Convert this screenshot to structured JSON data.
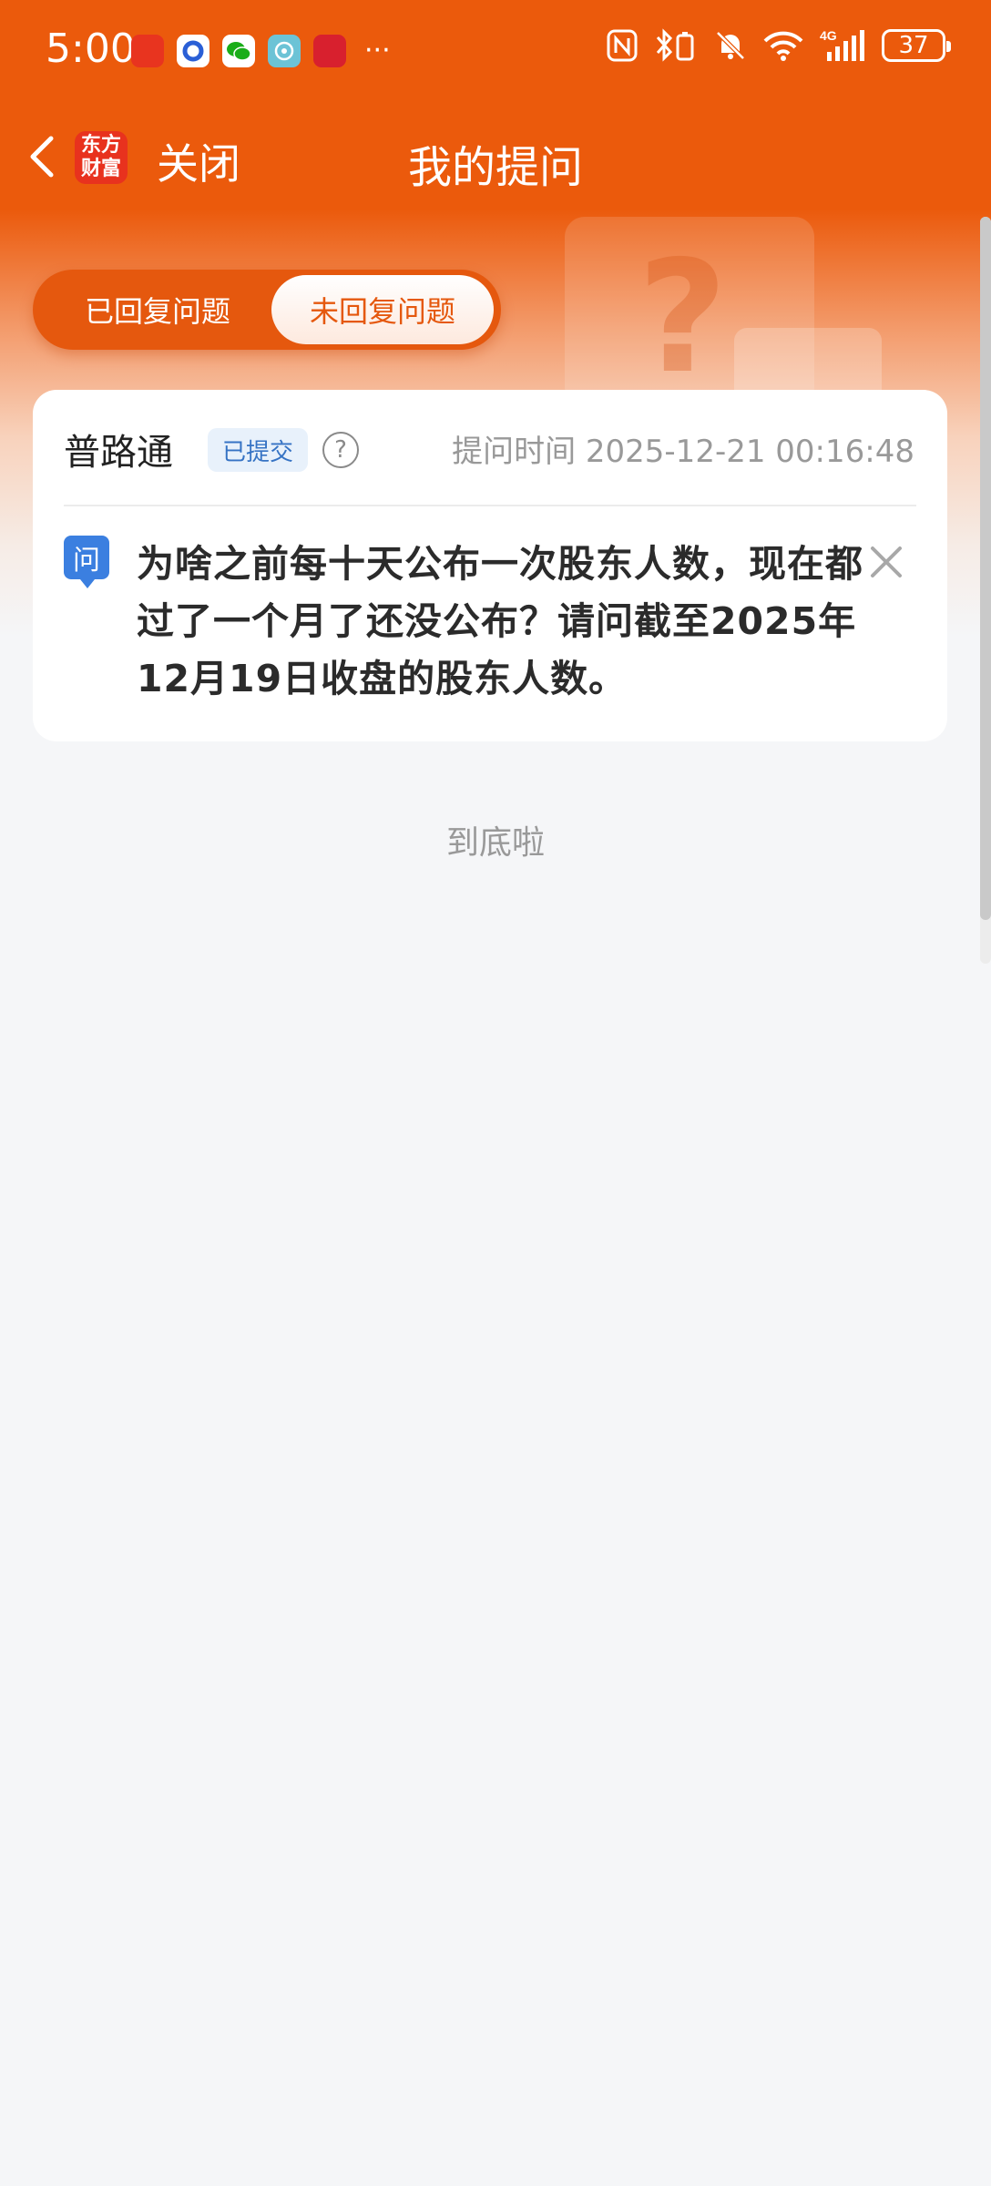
{
  "status_bar": {
    "time": "5:00",
    "battery": "37",
    "network": "4G",
    "app_icons": [
      "huawei-icon",
      "circle-app-icon",
      "wechat-icon",
      "browser-app-icon",
      "calendar-app-icon"
    ],
    "system_icons": [
      "nfc-icon",
      "bluetooth-icon",
      "mute-icon",
      "wifi-icon",
      "signal-icon"
    ]
  },
  "nav": {
    "logo_line1": "东方",
    "logo_line2": "财富",
    "close_label": "关闭",
    "title": "我的提问"
  },
  "tabs": [
    {
      "label": "已回复问题",
      "selected": false
    },
    {
      "label": "未回复问题",
      "selected": true
    }
  ],
  "question_card": {
    "stock_name": "普路通",
    "status": "已提交",
    "help_symbol": "?",
    "time_label": "提问时间 2025-12-21 00:16:48",
    "q_badge": "问",
    "question": "为啥之前每十天公布一次股东人数，现在都过了一个月了还没公布？请问截至2025年12月19日收盘的股东人数。"
  },
  "footer_note": "到底啦",
  "colors": {
    "brand_orange": "#eb5a0c",
    "tab_bg": "#e5580e",
    "badge_blue": "#3673c4",
    "q_icon_blue": "#3b7fe0",
    "page_bg": "#f5f6f8"
  }
}
